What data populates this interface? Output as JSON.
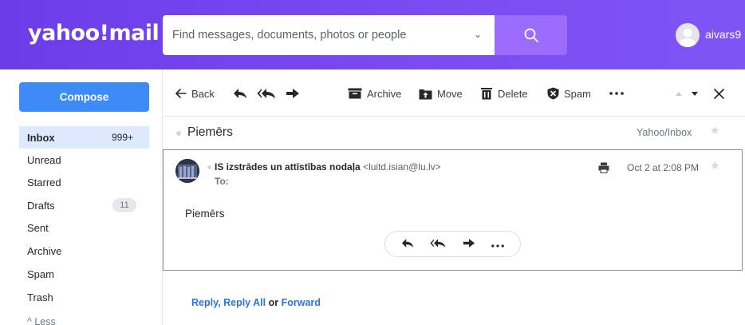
{
  "header": {
    "logo": "yahoo!mail",
    "search": {
      "placeholder": "Find messages, documents, photos or people"
    },
    "username": "aivars9"
  },
  "sidebar": {
    "compose_label": "Compose",
    "folders": [
      {
        "label": "Inbox",
        "count": "999+",
        "active": true
      },
      {
        "label": "Unread"
      },
      {
        "label": "Starred"
      },
      {
        "label": "Drafts",
        "count": "11"
      },
      {
        "label": "Sent"
      },
      {
        "label": "Archive"
      },
      {
        "label": "Spam"
      },
      {
        "label": "Trash"
      }
    ],
    "less_label": "^ Less"
  },
  "toolbar": {
    "back_label": "Back",
    "archive_label": "Archive",
    "move_label": "Move",
    "delete_label": "Delete",
    "spam_label": "Spam"
  },
  "message": {
    "subject": "Piemērs",
    "folder_path": "Yahoo/Inbox",
    "sender_name": "IS izstrādes un attīstības nodaļa",
    "sender_email": "<luitd.isian@lu.lv>",
    "to_label": "To:",
    "date": "Oct 2 at 2:08 PM",
    "body": "Piemērs"
  },
  "reply_links": {
    "reply": "Reply",
    "comma": ",",
    "reply_all": "Reply All",
    "or": "or",
    "forward": "Forward"
  },
  "colors": {
    "header_gradient_start": "#6c3ce9",
    "search_button": "#9b6cfd",
    "compose": "#3c8bf7",
    "active_folder": "#dde9fd",
    "link": "#2a75e5"
  },
  "icons": [
    "search-icon",
    "chevron-down-icon",
    "user-avatar-icon",
    "back-arrow-icon",
    "reply-icon",
    "reply-all-icon",
    "forward-icon",
    "archive-icon",
    "move-icon",
    "delete-icon",
    "spam-icon",
    "more-icon",
    "chevron-up-icon",
    "chevron-down-icon",
    "close-icon",
    "star-icon",
    "print-icon"
  ]
}
